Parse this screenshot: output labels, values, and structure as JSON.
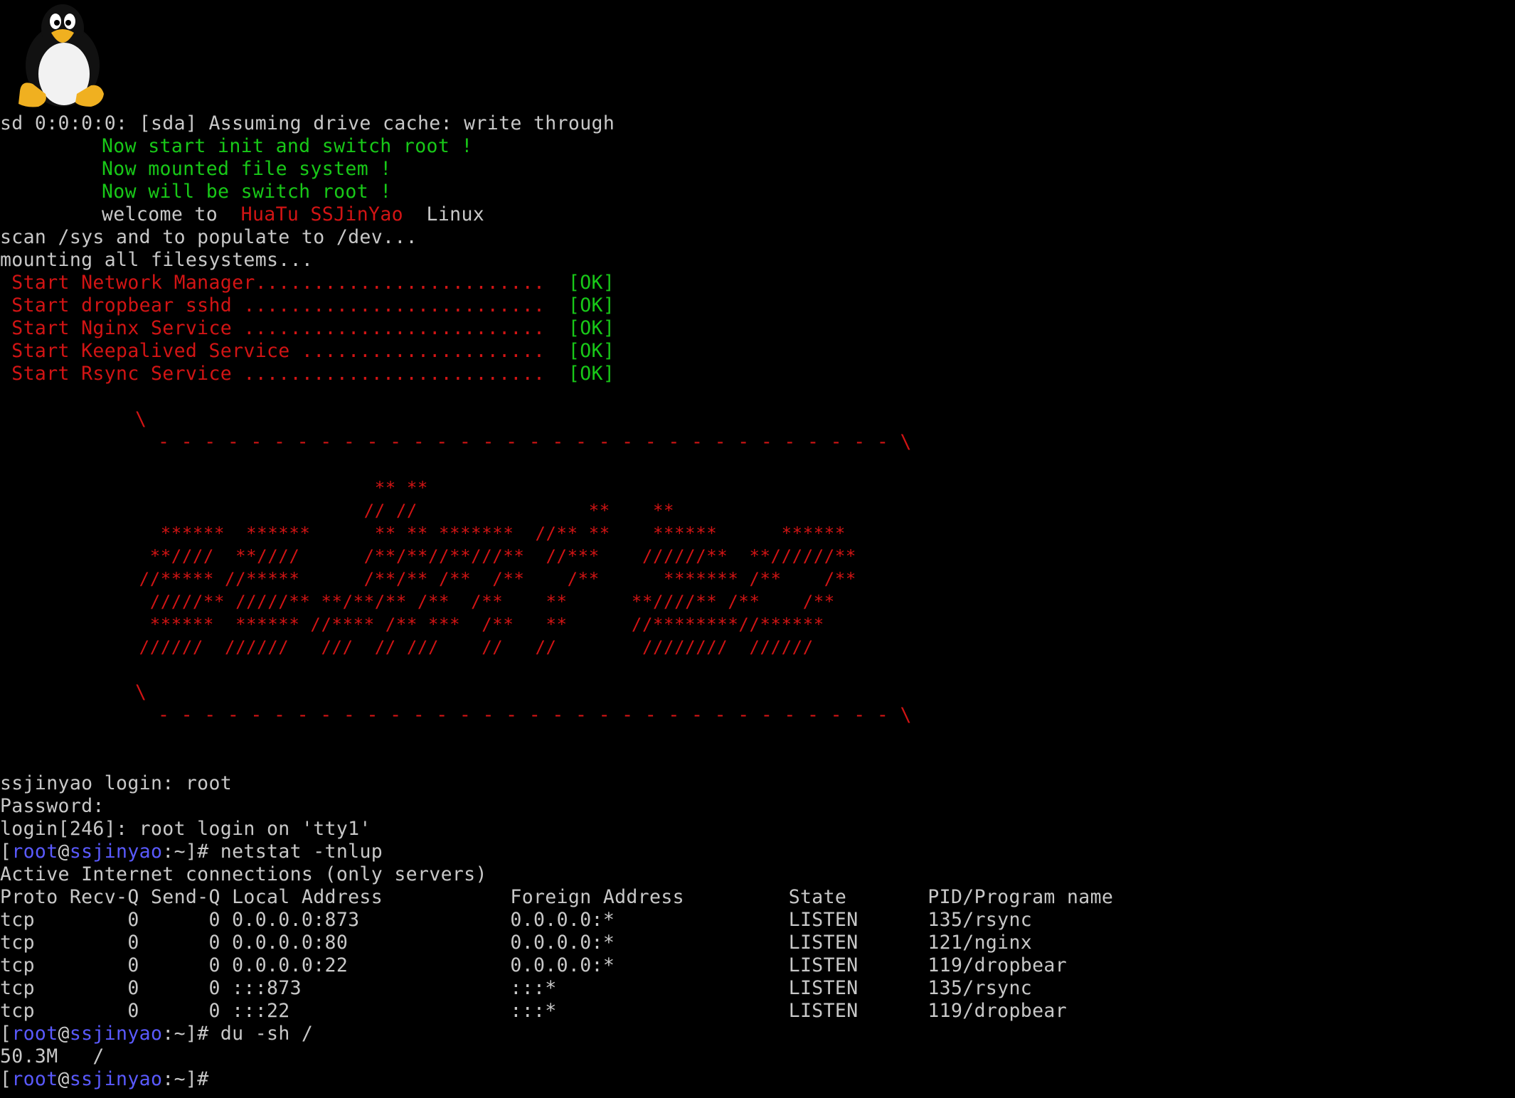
{
  "boot": {
    "line1": "sd 0:0:0:0: [sda] Assuming drive cache: write through",
    "line2": "Now start init and switch root !",
    "line3": "Now mounted file system !",
    "line4": "Now will be switch root !",
    "welcome_prefix": "welcome to ",
    "welcome_brand": "HuaTu SSJinYao",
    "welcome_suffix": " Linux",
    "line6": "scan /sys and to populate to /dev...",
    "line7": "mounting all filesystems...",
    "services": [
      {
        "label": " Start Network Manager.........................",
        "status": "[OK]"
      },
      {
        "label": " Start dropbear sshd ..........................",
        "status": "[OK]"
      },
      {
        "label": " Start Nginx Service ..........................",
        "status": "[OK]"
      },
      {
        "label": " Start Keepalived Service .....................",
        "status": "[OK]"
      },
      {
        "label": " Start Rsync Service ..........................",
        "status": "[OK]"
      }
    ]
  },
  "banner": {
    "top_slash": "\\",
    "top_dashes": "- - - - - - - - - - - - - - - - - - - - - - - - - - - - - - - - \\",
    "art": [
      "                                   ** **",
      "                                  // //                **    **",
      "               ******  ******      ** ** *******  //** **    ******      ******",
      "              **////  **////      /**/**//**///**  //***    //////**  **//////**",
      "             //***** //*****      /**/** /**  /**    /**      ******* /**    /**",
      "              /////** /////** **/**/** /**  /**    **      **////** /**    /**",
      "              ******  ****** //**** /** ***  /**   **      //********//******",
      "             //////  //////   ///  // ///    //   //        ////////  //////"
    ],
    "bottom_slash": "\\",
    "bottom_dashes": "- - - - - - - - - - - - - - - - - - - - - - - - - - - - - - - - \\"
  },
  "session": {
    "login_line": "ssjinyao login: root",
    "password_line": "Password:",
    "login_msg": "login[246]: root login on 'tty1'",
    "prompt_open": "[",
    "prompt_user": "root",
    "prompt_at": "@",
    "prompt_host": "ssjinyao",
    "prompt_close": ":~]#",
    "cmd1": " netstat -tnlup",
    "netstat_title": "Active Internet connections (only servers)",
    "netstat_header": "Proto Recv-Q Send-Q Local Address           Foreign Address         State       PID/Program name",
    "netstat_rows": [
      "tcp        0      0 0.0.0.0:873             0.0.0.0:*               LISTEN      135/rsync",
      "tcp        0      0 0.0.0.0:80              0.0.0.0:*               LISTEN      121/nginx",
      "tcp        0      0 0.0.0.0:22              0.0.0.0:*               LISTEN      119/dropbear",
      "tcp        0      0 :::873                  :::*                    LISTEN      135/rsync",
      "tcp        0      0 :::22                   :::*                    LISTEN      119/dropbear"
    ],
    "cmd2": " du -sh /",
    "du_output": "50.3M   /"
  }
}
